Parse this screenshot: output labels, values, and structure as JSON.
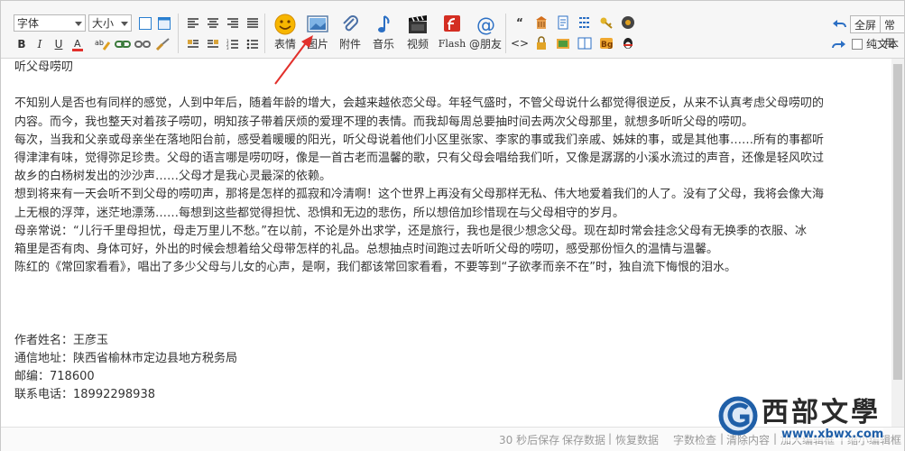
{
  "toolbar": {
    "font_select": "字体",
    "size_select": "大小",
    "big_buttons": [
      {
        "label": "表情",
        "icon": "smile-icon"
      },
      {
        "label": "图片",
        "icon": "image-icon"
      },
      {
        "label": "附件",
        "icon": "paperclip-icon"
      },
      {
        "label": "音乐",
        "icon": "music-note-icon"
      },
      {
        "label": "视频",
        "icon": "clapperboard-icon"
      },
      {
        "label": "Flash",
        "icon": "flash-icon"
      },
      {
        "label": "@朋友",
        "icon": "at-icon"
      }
    ],
    "fullscreen_label": "全屏",
    "common_label": "常用",
    "plaintext_label": "纯文本",
    "plaintext_checked": false
  },
  "content": {
    "lines": [
      "听父母唠叨",
      "",
      "不知别人是否也有同样的感觉，人到中年后，随着年龄的增大，会越来越依恋父母。年轻气盛时，不管父母说什么都觉得很逆反，从来不认真考虑父母唠叨的",
      "内容。而今，我也整天对着孩子唠叨，明知孩子带着厌烦的爱理不理的表情。而我却每周总要抽时间去两次父母那里，就想多听听父母的唠叨。",
      "每次，当我和父亲或母亲坐在落地阳台前，感受着暖暖的阳光，听父母说着他们小区里张家、李家的事或我们亲戚、姊妹的事，或是其他事……所有的事都听",
      "得津津有味，觉得弥足珍贵。父母的语言哪是唠叨呀，像是一首古老而温馨的歌，只有父母会唱给我们听，又像是潺潺的小溪水流过的声音，还像是轻风吹过",
      "故乡的白杨树发出的沙沙声……父母才是我心灵最深的依赖。",
      "想到将来有一天会听不到父母的唠叨声，那将是怎样的孤寂和冷清啊！这个世界上再没有父母那样无私、伟大地爱着我们的人了。没有了父母，我将会像大海",
      "上无根的浮萍，迷茫地漂荡……每想到这些都觉得担忧、恐惧和无边的悲伤，所以想倍加珍惜现在与父母相守的岁月。",
      "母亲常说：“儿行千里母担忧，母走万里儿不愁。”在以前，不论是外出求学，还是旅行，我也是很少想念父母。现在却时常会挂念父母有无换季的衣服、冰",
      "箱里是否有肉、身体可好，外出的时候会想着给父母带怎样的礼品。总想抽点时间跑过去听听父母的唠叨，感受那份恒久的温情与温馨。",
      "陈红的《常回家看看》，唱出了多少父母与儿女的心声，是啊，我们都该常回家看看，不要等到“子欲孝而亲不在”时，独自流下悔恨的泪水。",
      "",
      "",
      "",
      "作者姓名：王彦玉",
      "通信地址：陕西省榆林市定边县地方税务局",
      "邮编：718600",
      "联系电话：18992298938"
    ]
  },
  "status": {
    "autosave": "30 秒后保存",
    "save_data": "保存数据",
    "restore_data": "恢复数据",
    "word_check": "字数检查",
    "clear_content": "清除内容",
    "enlarge_editor": "加大编辑框",
    "shrink_editor": "缩小编辑框",
    "sep": "|"
  },
  "watermark": {
    "title": "西部文學",
    "url": "www.xbwx.com"
  },
  "colors": {
    "toolbar_bg": "#f6f6f6",
    "text": "#333333",
    "status_text": "#9a9a9a",
    "arrow": "#e2302b",
    "watermark_blue": "#1f5fa8"
  }
}
